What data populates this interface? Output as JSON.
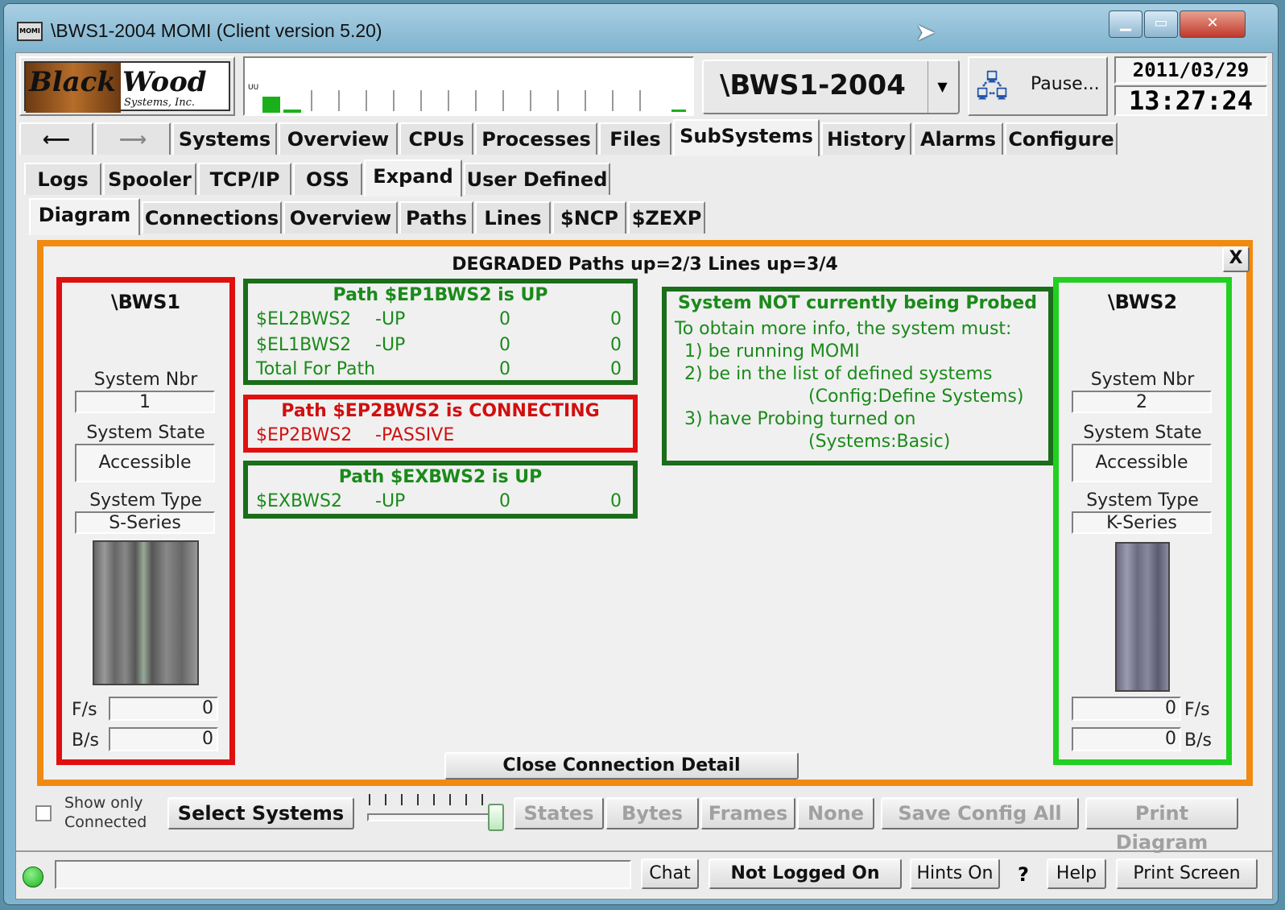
{
  "window": {
    "title": "\\BWS1-2004 MOMI (Client version 5.20)",
    "app_icon": "MOMI",
    "controls": [
      "minimize",
      "maximize",
      "close"
    ]
  },
  "header": {
    "logo_text1": "Black",
    "logo_text2": "Wood",
    "logo_sub": "Systems, Inc.",
    "system_selector": "\\BWS1-2004",
    "pause_label": "Pause...",
    "date": "2011/03/29",
    "time": "13:27:24",
    "graph_label": "UU"
  },
  "main_tabs": [
    "Systems",
    "Overview",
    "CPUs",
    "Processes",
    "Files",
    "SubSystems",
    "History",
    "Alarms",
    "Configure"
  ],
  "sub_tabs": [
    "Logs",
    "Spooler",
    "TCP/IP",
    "OSS",
    "Expand",
    "User Defined"
  ],
  "expand_tabs": [
    "Diagram",
    "Connections",
    "Overview",
    "Paths",
    "Lines",
    "$NCP",
    "$ZEXP"
  ],
  "diagram": {
    "status": "DEGRADED Paths up=2/3 Lines up=3/4",
    "close_label": "X",
    "left": {
      "name": "\\BWS1",
      "nbr_label": "System Nbr",
      "nbr": "1",
      "state_label": "System State",
      "state": "Accessible",
      "type_label": "System Type",
      "type": "S-Series",
      "fs_label": "F/s",
      "fs": "0",
      "bs_label": "B/s",
      "bs": "0"
    },
    "right": {
      "name": "\\BWS2",
      "nbr_label": "System Nbr",
      "nbr": "2",
      "state_label": "System State",
      "state": "Accessible",
      "type_label": "System Type",
      "type": "K-Series",
      "fs_label": "F/s",
      "fs": "0",
      "bs_label": "B/s",
      "bs": "0"
    },
    "paths": [
      {
        "title": "Path $EP1BWS2 is UP",
        "rows": [
          {
            "line": "$EL2BWS2",
            "state": "-UP",
            "a": "0",
            "b": "0"
          },
          {
            "line": "$EL1BWS2",
            "state": "-UP",
            "a": "0",
            "b": "0"
          },
          {
            "line": "Total For Path",
            "state": "",
            "a": "0",
            "b": "0"
          }
        ]
      },
      {
        "title": "Path $EP2BWS2 is CONNECTING",
        "rows": [
          {
            "line": "$EP2BWS2",
            "state": "-PASSIVE"
          }
        ]
      },
      {
        "title": "Path $EXBWS2 is UP",
        "rows": [
          {
            "line": "$EXBWS2",
            "state": "-UP",
            "a": "0",
            "b": "0"
          }
        ]
      }
    ],
    "probe": {
      "title": "System NOT currently being Probed",
      "l1": "To obtain more info, the system must:",
      "l2": "1) be running MOMI",
      "l3": "2) be in the list of defined systems",
      "l4": "(Config:Define Systems)",
      "l5": "3) have Probing turned on",
      "l6": "(Systems:Basic)"
    },
    "close_detail": "Close Connection Detail"
  },
  "toolbar": {
    "show_only": "Show only",
    "connected": "Connected",
    "select_systems": "Select Systems",
    "states": "States",
    "bytes": "Bytes",
    "frames": "Frames",
    "none": "None",
    "save_config": "Save Config All",
    "print_diagram": "Print Diagram"
  },
  "statusbar": {
    "chat": "Chat",
    "logon": "Not Logged On",
    "hints": "Hints On",
    "question": "?",
    "help": "Help",
    "print_screen": "Print Screen"
  },
  "colors": {
    "orange": "#f08a10",
    "red": "#e01010",
    "green": "#22d022",
    "dark_green": "#1a6e1a"
  }
}
